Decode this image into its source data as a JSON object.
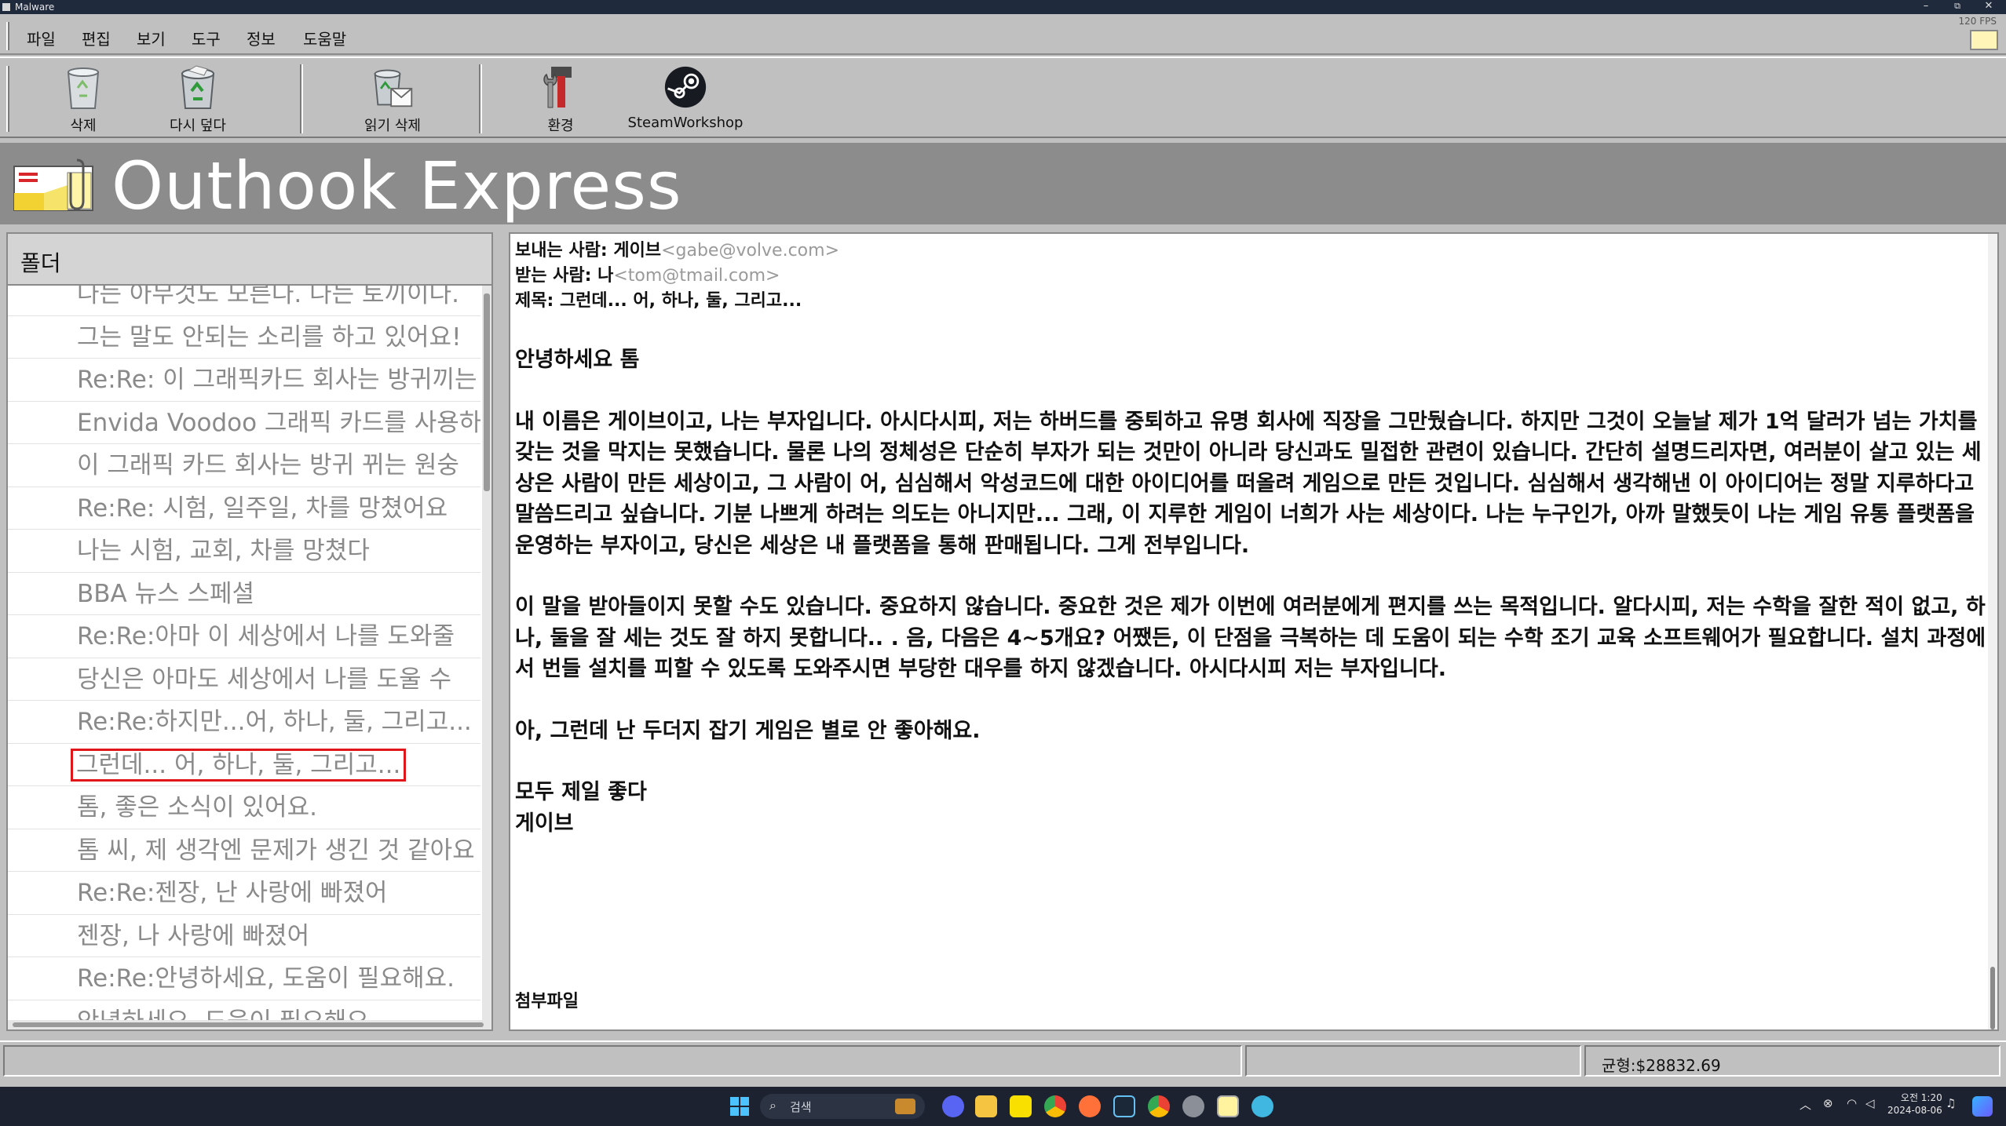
{
  "window": {
    "title": "Malware",
    "minimize": "–",
    "restore": "⧉",
    "close": "✕"
  },
  "menubar": {
    "items": [
      "파일",
      "편집",
      "보기",
      "도구",
      "정보",
      "도움말"
    ],
    "fps": "120 FPS"
  },
  "toolbar": {
    "delete_label": "삭제",
    "restore_label": "다시 덮다",
    "read_delete_label": "읽기 삭제",
    "settings_label": "환경",
    "steam_label": "SteamWorkshop"
  },
  "banner": {
    "title": "Outhook Express"
  },
  "folder": {
    "header": "폴더",
    "selected_index": 11,
    "items": [
      "나는 아무것도 모른다. 나는 토끼이다.",
      "그는 말도 안되는 소리를 하고 있어요!",
      "Re:Re: 이 그래픽카드 회사는 방귀끼는",
      "Envida Voodoo 그래픽 카드를 사용하",
      "이 그래픽 카드 회사는 방귀 뀌는 원숭",
      "Re:Re: 시험, 일주일, 차를 망쳤어요",
      "나는 시험, 교회, 차를 망쳤다",
      "BBA 뉴스 스페셜",
      "Re:Re:아마 이 세상에서 나를 도와줄",
      "당신은 아마도 세상에서 나를 도울 수",
      "Re:Re:하지만...어, 하나, 둘, 그리고...",
      "그런데... 어, 하나, 둘, 그리고...",
      "톰, 좋은 소식이 있어요.",
      "톰 씨, 제 생각엔 문제가 생긴 것 같아요",
      "Re:Re:젠장, 난 사랑에 빠졌어",
      "젠장, 나 사랑에 빠졌어",
      "Re:Re:안녕하세요, 도움이 필요해요.",
      "안녕하세요, 도움이 필요해요."
    ]
  },
  "message": {
    "from_label": "보내는 사람: ",
    "from_name": "게이브",
    "from_addr": "<gabe@volve.com>",
    "to_label": "받는 사람: ",
    "to_name": "나",
    "to_addr": "<tom@tmail.com>",
    "subject_label": "제목: ",
    "subject": "그런데... 어, 하나, 둘, 그리고...",
    "greeting": "안녕하세요 톰",
    "para1": "내 이름은 게이브이고, 나는 부자입니다. 아시다시피, 저는 하버드를 중퇴하고 유명 회사에 직장을 그만뒀습니다. 하지만 그것이 오늘날 제가 1억 달러가 넘는 가치를 갖는 것을 막지는 못했습니다. 물론 나의 정체성은 단순히 부자가 되는 것만이 아니라 당신과도 밀접한 관련이 있습니다. 간단히 설명드리자면, 여러분이 살고 있는 세상은 사람이 만든 세상이고, 그 사람이 어, 심심해서 악성코드에 대한 아이디어를 떠올려 게임으로 만든 것입니다. 심심해서 생각해낸 이 아이디어는 정말 지루하다고 말씀드리고 싶습니다. 기분 나쁘게 하려는 의도는 아니지만... 그래, 이 지루한 게임이 너희가 사는 세상이다. 나는 누구인가, 아까 말했듯이 나는 게임 유통 플랫폼을 운영하는 부자이고, 당신은 세상은 내 플랫폼을 통해 판매됩니다. 그게 전부입니다.",
    "para2": "이 말을 받아들이지 못할 수도 있습니다. 중요하지 않습니다. 중요한 것은 제가 이번에 여러분에게 편지를 쓰는 목적입니다. 알다시피, 저는 수학을 잘한 적이 없고, 하나, 둘을 잘 세는 것도 잘 하지 못합니다.. . 음, 다음은 4~5개요? 어쨌든, 이 단점을 극복하는 데 도움이 되는 수학 조기 교육 소프트웨어가 필요합니다. 설치 과정에서 번들 설치를 피할 수 있도록 도와주시면 부당한 대우를 하지 않겠습니다. 아시다시피 저는 부자입니다.",
    "para3": "아, 그런데 난 두더지 잡기 게임은 별로 안 좋아해요.",
    "closing": "모두 제일 좋다",
    "signature": "게이브",
    "attachment_label": "첨부파일"
  },
  "statusbar": {
    "balance": "균형:$28832.69"
  },
  "taskbar": {
    "search_placeholder": "검색",
    "clock_time": "오전 1:20",
    "clock_date": "2024-08-06"
  }
}
